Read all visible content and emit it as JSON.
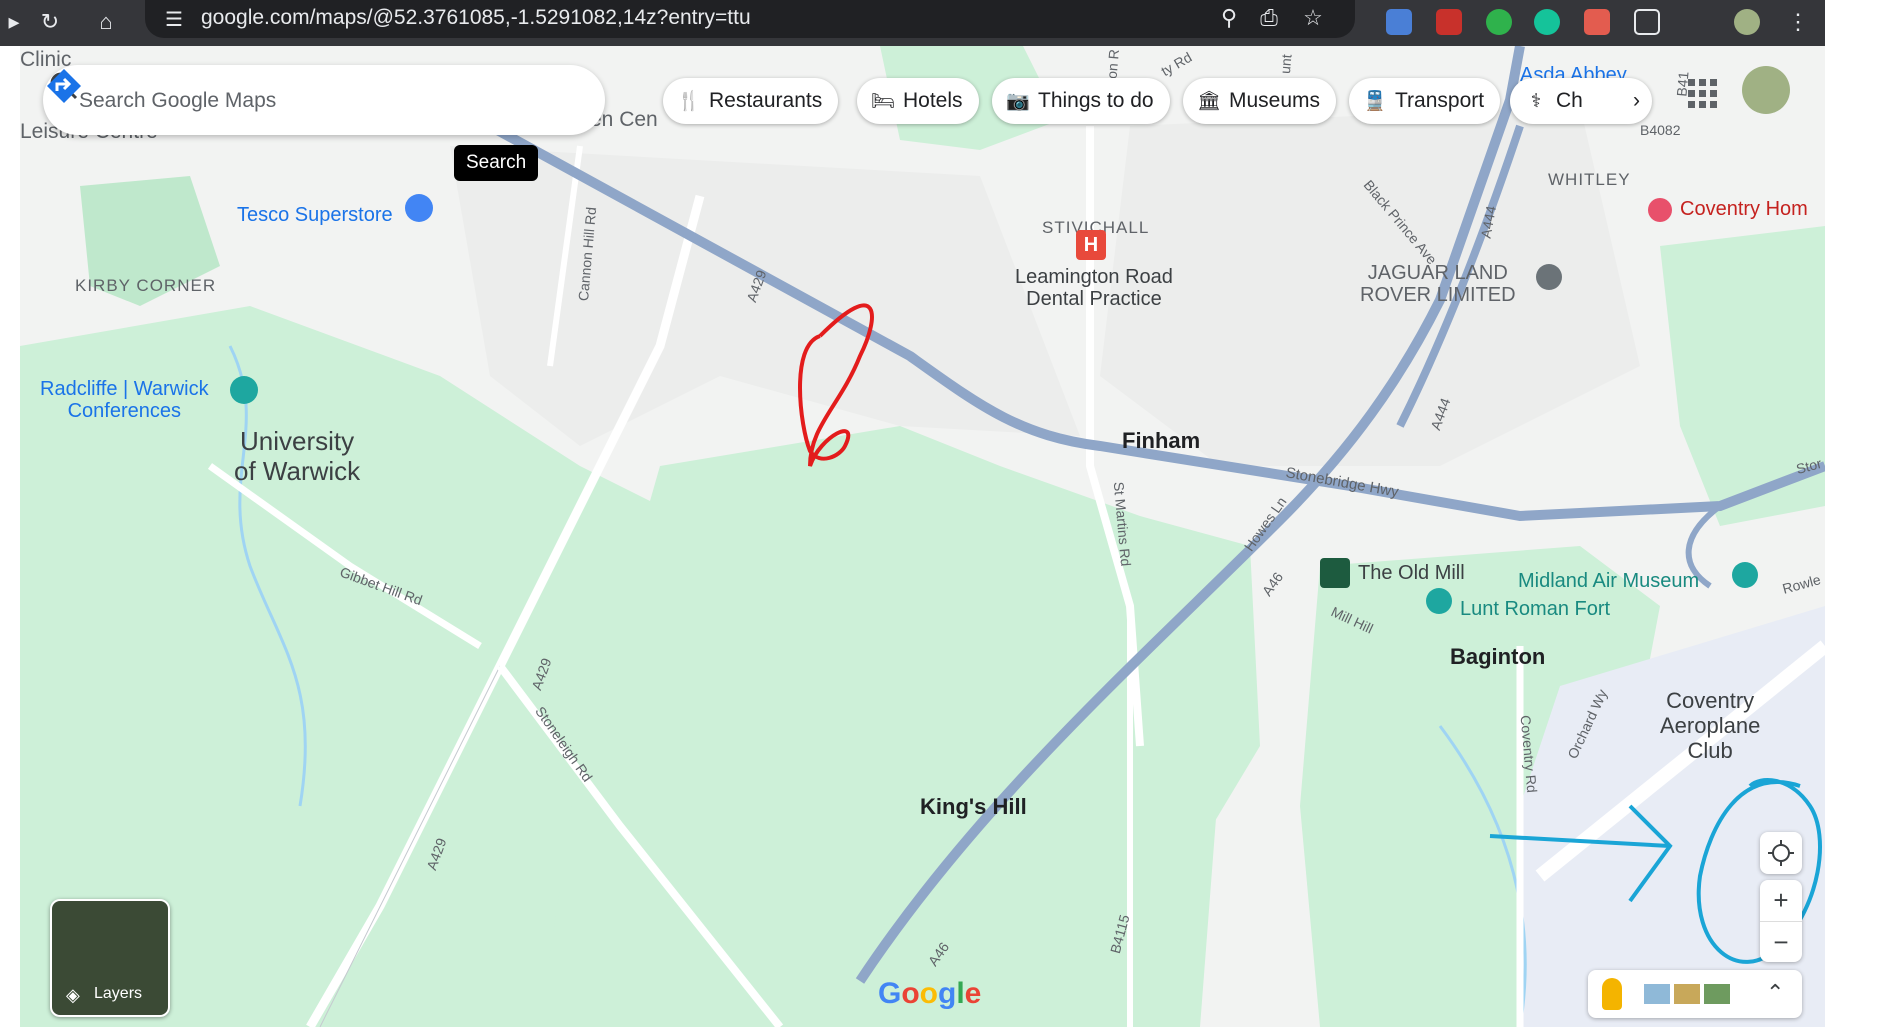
{
  "browser": {
    "url": "google.com/maps/@52.3761085,-1.5291082,14z?entry=ttu"
  },
  "search": {
    "placeholder": "Search Google Maps",
    "tooltip": "Search"
  },
  "chips": [
    {
      "icon": "restaurant-icon",
      "label": "Restaurants"
    },
    {
      "icon": "hotel-icon",
      "label": "Hotels"
    },
    {
      "icon": "camera-icon",
      "label": "Things to do"
    },
    {
      "icon": "museum-icon",
      "label": "Museums"
    },
    {
      "icon": "transit-icon",
      "label": "Transport"
    },
    {
      "icon": "chemist-icon",
      "label": "Ch"
    }
  ],
  "map": {
    "places": {
      "kirby_corner": "KIRBY CORNER",
      "stivichall": "STIVICHALL",
      "whitley": "WHITLEY",
      "university": "University\nof Warwick",
      "finham": "Finham",
      "kings_hill": "King's Hill",
      "baginton": "Baginton",
      "aeroplane_club": "Coventry\nAeroplane\nClub",
      "clinic": "Clinic",
      "leisure": "Leisure Centre",
      "shopping": "en Cen"
    },
    "pois": {
      "tesco": "Tesco Superstore",
      "radcliffe": "Radcliffe | Warwick\nConferences",
      "dental": "Leamington Road\nDental Practice",
      "jaguar": "JAGUAR LAND\nROVER LIMITED",
      "old_mill": "The Old Mill",
      "midland_air": "Midland Air Museum",
      "lunt": "Lunt Roman Fort",
      "coventry_home": "Coventry Hom",
      "asda": "Asda Abbey"
    },
    "roads": {
      "a429_n": "A429",
      "a429_m": "A429",
      "a429_s": "A429",
      "cannon_hill": "Cannon Hill Rd",
      "gibbet_hill": "Gibbet Hill Rd",
      "stoneleigh": "Stoneleigh Rd",
      "st_martins": "St Martins Rd",
      "stonebridge": "Stonebridge Hwy",
      "howes": "Howes Ln",
      "a46_n": "A46",
      "a46_s": "A46",
      "mill_hill": "Mill Hill",
      "coventry_rd": "Coventry Rd",
      "orchard": "Orchard Wy",
      "black_prince": "Black Prince Ave",
      "a444_n": "A444",
      "a444_s": "A444",
      "b4115": "B4115",
      "b4082": "B4082",
      "rowley": "Rowle",
      "stor": "Stor",
      "ty_rd": "ty Rd",
      "on_r": "on R",
      "unt": "unt",
      "b41": "B41"
    },
    "logo": "Google"
  },
  "controls": {
    "layers_label": "Layers",
    "zoom_in": "+",
    "zoom_out": "−"
  },
  "annotations": {
    "red_scribble": "red-freehand-circle",
    "blue_circle": "blue-freehand-circle",
    "blue_arrow": "blue-arrow"
  },
  "colors": {
    "green_area": "#cdf0d8",
    "road_major": "#8fa6c8",
    "water": "#9fd4f3",
    "annotation_red": "#e31c1c",
    "annotation_blue": "#1aa5d6",
    "poi_blue": "#1a73e8",
    "airport": "#e8ecf5"
  }
}
